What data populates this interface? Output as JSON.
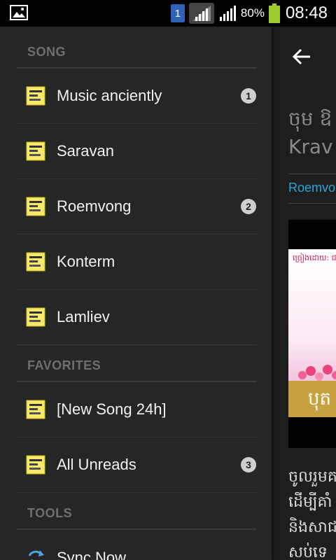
{
  "status_bar": {
    "sim_slot": "1",
    "battery_percent": "80%",
    "time": "08:48"
  },
  "drawer": {
    "sections": {
      "song": "SONG",
      "favorites": "FAVORITES",
      "tools": "TOOLS"
    },
    "song_items": [
      {
        "label": "Music anciently",
        "badge": "1"
      },
      {
        "label": "Saravan",
        "badge": ""
      },
      {
        "label": "Roemvong",
        "badge": "2"
      },
      {
        "label": "Konterm",
        "badge": ""
      },
      {
        "label": "Lamliev",
        "badge": ""
      }
    ],
    "favorite_items": [
      {
        "label": "[New Song 24h]",
        "badge": ""
      },
      {
        "label": "All Unreads",
        "badge": "3"
      }
    ],
    "tool_items": [
      {
        "label": "Sync Now"
      }
    ]
  },
  "main": {
    "title_line1": "ចុម ឱ",
    "title_line2": "Krav I",
    "category": "Roemvo",
    "video_tag": "ច្រៀងដោយ: ជា",
    "video_band_text": "បុត",
    "body_lines": [
      "ចូលរួមគ",
      "ដើម្បីគាំ",
      "និងសាជ",
      "សប់ទេ"
    ]
  },
  "colors": {
    "accent_link": "#2aa7d8",
    "drawer_bg": "#262626",
    "section_header": "#6f6f6f"
  }
}
